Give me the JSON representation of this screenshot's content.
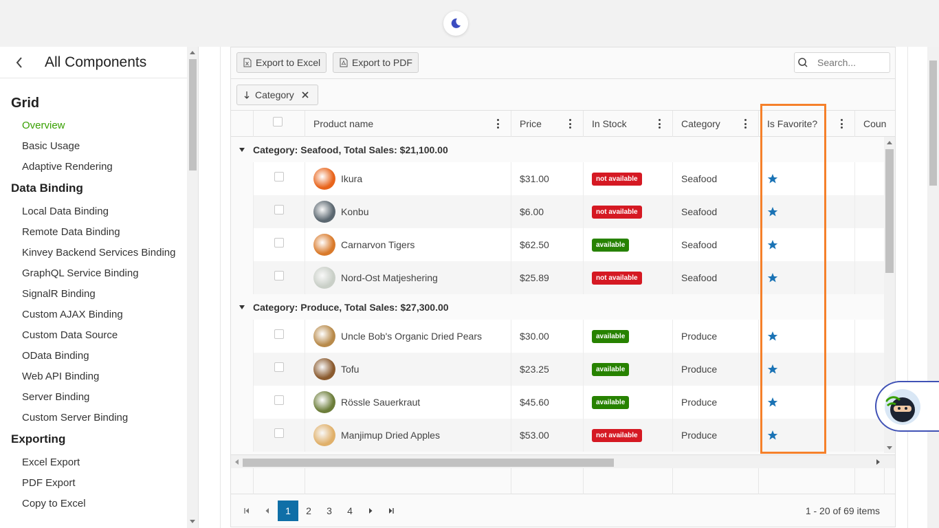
{
  "sidebar": {
    "title": "All Components",
    "sections": [
      {
        "label": "Grid",
        "items": [
          {
            "label": "Overview",
            "active": true
          },
          {
            "label": "Basic Usage"
          },
          {
            "label": "Adaptive Rendering"
          }
        ]
      },
      {
        "label": "Data Binding",
        "items": [
          {
            "label": "Local Data Binding"
          },
          {
            "label": "Remote Data Binding"
          },
          {
            "label": "Kinvey Backend Services Binding"
          },
          {
            "label": "GraphQL Service Binding"
          },
          {
            "label": "SignalR Binding"
          },
          {
            "label": "Custom AJAX Binding"
          },
          {
            "label": "Custom Data Source"
          },
          {
            "label": "OData Binding"
          },
          {
            "label": "Web API Binding"
          },
          {
            "label": "Server Binding"
          },
          {
            "label": "Custom Server Binding"
          }
        ]
      },
      {
        "label": "Exporting",
        "items": [
          {
            "label": "Excel Export"
          },
          {
            "label": "PDF Export"
          },
          {
            "label": "Copy to Excel"
          }
        ]
      }
    ]
  },
  "toolbar": {
    "export_excel": "Export to Excel",
    "export_pdf": "Export to PDF",
    "search_placeholder": "Search..."
  },
  "group_chip": {
    "label": "Category"
  },
  "columns": [
    "Product name",
    "Price",
    "In Stock",
    "Category",
    "Is Favorite?",
    "Coun"
  ],
  "groups": [
    {
      "header": "Category: Seafood, Total Sales: $21,100.00",
      "rows": [
        {
          "name": "Ikura",
          "price": "$31.00",
          "stock": "not available",
          "category": "Seafood",
          "img": "#e8641b"
        },
        {
          "name": "Konbu",
          "price": "$6.00",
          "stock": "not available",
          "category": "Seafood",
          "img": "#5b6770"
        },
        {
          "name": "Carnarvon Tigers",
          "price": "$62.50",
          "stock": "available",
          "category": "Seafood",
          "img": "#d97a2b"
        },
        {
          "name": "Nord-Ost Matjeshering",
          "price": "$25.89",
          "stock": "not available",
          "category": "Seafood",
          "img": "#c9cfc7"
        }
      ]
    },
    {
      "header": "Category: Produce, Total Sales: $27,300.00",
      "rows": [
        {
          "name": "Uncle Bob's Organic Dried Pears",
          "price": "$30.00",
          "stock": "available",
          "category": "Produce",
          "img": "#b88a4a"
        },
        {
          "name": "Tofu",
          "price": "$23.25",
          "stock": "available",
          "category": "Produce",
          "img": "#8a5a2e"
        },
        {
          "name": "Rössle Sauerkraut",
          "price": "$45.60",
          "stock": "available",
          "category": "Produce",
          "img": "#6c7d3a"
        },
        {
          "name": "Manjimup Dried Apples",
          "price": "$53.00",
          "stock": "not available",
          "category": "Produce",
          "img": "#e0b06a"
        }
      ]
    }
  ],
  "pager": {
    "pages": [
      "1",
      "2",
      "3",
      "4"
    ],
    "active": "1",
    "info": "1 - 20 of 69 items"
  },
  "colors": {
    "accent": "#0f6fa7",
    "highlight": "#f5802a",
    "star": "#1a73b5",
    "active_nav": "#37a000"
  }
}
